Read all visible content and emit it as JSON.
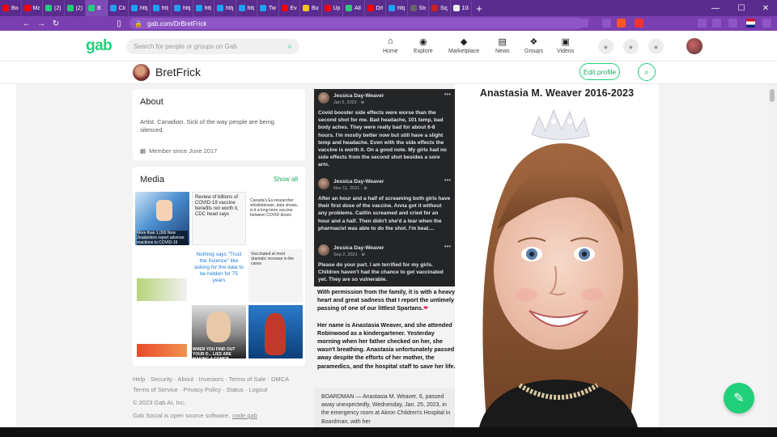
{
  "browser": {
    "tabs": [
      {
        "label": "Boo",
        "color": "#ff0000"
      },
      {
        "label": "Mar",
        "color": "#ff0000"
      },
      {
        "label": "(2) V",
        "color": "#21cf7a"
      },
      {
        "label": "(2) H",
        "color": "#21cf7a"
      },
      {
        "label": "B",
        "color": "#21cf7a"
      },
      {
        "label": "Clo",
        "color": "#1da1f2"
      },
      {
        "label": "http",
        "color": "#1da1f2"
      },
      {
        "label": "http",
        "color": "#1da1f2"
      },
      {
        "label": "http",
        "color": "#1da1f2"
      },
      {
        "label": "http",
        "color": "#1da1f2"
      },
      {
        "label": "http",
        "color": "#1da1f2"
      },
      {
        "label": "http",
        "color": "#1da1f2"
      },
      {
        "label": "Twit",
        "color": "#1da1f2"
      },
      {
        "label": "Ever",
        "color": "#ff0000"
      },
      {
        "label": "Buy",
        "color": "#f5c518"
      },
      {
        "label": "Upk",
        "color": "#ff0000"
      },
      {
        "label": "All V",
        "color": "#2ecc71"
      },
      {
        "label": "DrB",
        "color": "#ff0000"
      },
      {
        "label": "http",
        "color": "#1da1f2"
      },
      {
        "label": "Stea",
        "color": "#666666"
      },
      {
        "label": "Sign",
        "color": "#cc1f1f"
      },
      {
        "label": "10k",
        "color": "#eeeeee"
      }
    ],
    "active_tab_index": 4,
    "url": "gab.com/DrBretFrick"
  },
  "gab": {
    "logo": "gab",
    "search_placeholder": "Search for people or groups on Gab",
    "nav": [
      {
        "label": "Home",
        "icon": "home-icon",
        "glyph": "⌂"
      },
      {
        "label": "Explore",
        "icon": "explore-icon",
        "glyph": "◉"
      },
      {
        "label": "Marketplace",
        "icon": "marketplace-icon",
        "glyph": "◆"
      },
      {
        "label": "News",
        "icon": "news-icon",
        "glyph": "▤"
      },
      {
        "label": "Groups",
        "icon": "groups-icon",
        "glyph": "❖"
      },
      {
        "label": "Videos",
        "icon": "videos-icon",
        "glyph": "▣"
      }
    ]
  },
  "profile": {
    "name": "BretFrick",
    "edit_label": "Edit profile",
    "about_title": "About",
    "bio": "Artist. Canadian. Sick of the way people are being silenced.",
    "member_since": "Member since June 2017"
  },
  "media": {
    "title": "Media",
    "show_all": "Show all",
    "thumb_texts": {
      "t1": "More than 1,000 New Zealanders report adverse reactions to COVID-19 vaccines",
      "t2": "Review of billions of COVID-19 vaccine benefits not worth it, CDC head says",
      "t3": "Canada's Ex-researcher whistleblower, data shows, is it a long-term vaccine between COVID doses",
      "t5": "Nothing says \"Trust the Science\" like asking for the data to be hidden for 75 years",
      "t6": "Vaccinated at most dramatic increase in the cases",
      "t8": "WHEN YOU FIND OUT YOUR D... LIES ARE MAKING A COMEB..."
    }
  },
  "footer": {
    "links_line1": [
      "Help",
      "Security",
      "About",
      "Investors",
      "Terms of Sale",
      "DMCA"
    ],
    "links_line2": [
      "Terms of Service",
      "Privacy Policy",
      "Status",
      "Logout"
    ],
    "copyright": "© 2023 Gab AI, Inc.",
    "opensource_prefix": "Gab Social is open source software.",
    "opensource_link": "code.gab"
  },
  "post": {
    "fb_posts": [
      {
        "author": "Jessica Day-Weaver",
        "date": "Jan 5, 2022 · ⊕",
        "text": "Covid booster side effects were worse than the second shot for me. Bad headache, 101 temp, bad body aches. They were really bad for about 6-8 hours. I'm mostly better now but still have a slight temp and headache. Even with the side effects the vaccine is worth it. On a good note. My girls had no side effects from the second shot besides a sore arm."
      },
      {
        "author": "Jessica Day-Weaver",
        "date": "Nov 11, 2021 · ⊕",
        "text": "After an hour and a half of screaming both girls have their first dose of the vaccine. Anna got it without any problems. Caitlin screamed and cried for an hour and a half. Then didn't she'd a tear when the pharmacist was able to do the shot. I'm beat...."
      },
      {
        "author": "Jessica Day-Weaver",
        "date": "Sep 2, 2021 · ⊕",
        "text": "Please do your part. I am terrified for my girls. Children haven't had the chance to get vaccinated yet. They are so vulnerable."
      }
    ],
    "announce_p1": "With permission from the family, it is with a heavy heart and great sadness that I report the untimely passing of one of our littlest Spartans.",
    "announce_heart": "❤",
    "announce_p2": "Her name is Anastasia Weaver, and she attended Robinwood as a kindergartener. Yesterday morning when her father checked on her, she wasn't breathing. Anastasia unfortunately passed away despite the efforts of her mother, the paramedics, and the hospital staff to save her life.",
    "news_text": "BOARDMAN — Anastasia M. Weaver, 6, passed away unexpectedly, Wednesday, Jan. 25, 2023, in the emergency room at Akron Children's Hospital in Boardman, with her",
    "photo_caption": "Anastasia M. Weaver 2016-2023"
  }
}
